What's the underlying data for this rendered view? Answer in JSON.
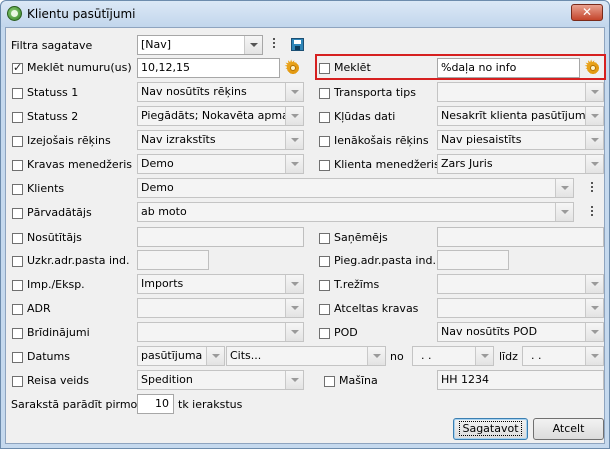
{
  "window": {
    "title": "Klientu pasūtījumi",
    "close_glyph": "✕"
  },
  "icons": {
    "app": "app-logo-icon",
    "settings": "gear-icon",
    "save": "save-disk-icon",
    "more": "more-dots-icon"
  },
  "filter": {
    "label": "Filtra sagatave",
    "value": "[Nav]"
  },
  "row_search_no": {
    "label": "Meklēt numuru(us)",
    "checked": true,
    "value": "10,12,15"
  },
  "row_search_text": {
    "label": "Meklēt",
    "checked": false,
    "value": "%daļa no info"
  },
  "left": {
    "status1": {
      "label": "Statuss 1",
      "value": "Nav nosūtīts rēķins"
    },
    "status2": {
      "label": "Statuss 2",
      "value": "Piegādāts; Nokavēta apmaksa"
    },
    "out_invoice": {
      "label": "Izejošais rēķins",
      "value": "Nav izrakstīts"
    },
    "manager": {
      "label": "Kravas menedžeris",
      "value": "Demo"
    },
    "client": {
      "label": "Klients",
      "value": "Demo"
    },
    "carrier": {
      "label": "Pārvadātājs",
      "value": "ab moto"
    },
    "sender": {
      "label": "Nosūtītājs",
      "value": ""
    },
    "load_email": {
      "label": "Uzkr.adr.pasta ind.",
      "value": ""
    },
    "impexp": {
      "label": "Imp./Eksp.",
      "value": "Imports"
    },
    "adr": {
      "label": "ADR",
      "value": ""
    },
    "warnings": {
      "label": "Brīdinājumi",
      "value": ""
    },
    "date": {
      "label": "Datums",
      "type_value": "pasūtījuma",
      "period_value": "Cits...",
      "from_label": "no",
      "from_value": ". .",
      "to_label": "līdz",
      "to_value": ". ."
    },
    "trip_type": {
      "label": "Reisa veids",
      "value": "Spedition"
    }
  },
  "right": {
    "transport": {
      "label": "Transporta tips",
      "value": ""
    },
    "errors": {
      "label": "Kļūdas dati",
      "value": "Nesakrīt klienta pasūtījumu ieņēmumi"
    },
    "in_invoice": {
      "label": "Ienākošais rēķins",
      "value": "Nav piesaistīts"
    },
    "client_manager": {
      "label": "Klienta menedžeris",
      "value": "Zars Juris"
    },
    "receiver": {
      "label": "Saņēmējs",
      "value": ""
    },
    "unload_email": {
      "label": "Pieg.adr.pasta ind.",
      "value": ""
    },
    "t_regime": {
      "label": "T.režīms",
      "value": ""
    },
    "cancelled": {
      "label": "Atceltas kravas",
      "value": ""
    },
    "pod": {
      "label": "POD",
      "value": "Nav nosūtīts POD"
    },
    "vehicle": {
      "label": "Mašīna",
      "value": "HH 1234"
    }
  },
  "footer": {
    "show_label": "Sarakstā parādīt pirmos",
    "show_value": "10",
    "records_label": "tk ierakstus",
    "generate_button": "Sagatavot",
    "cancel_button": "Atcelt"
  }
}
